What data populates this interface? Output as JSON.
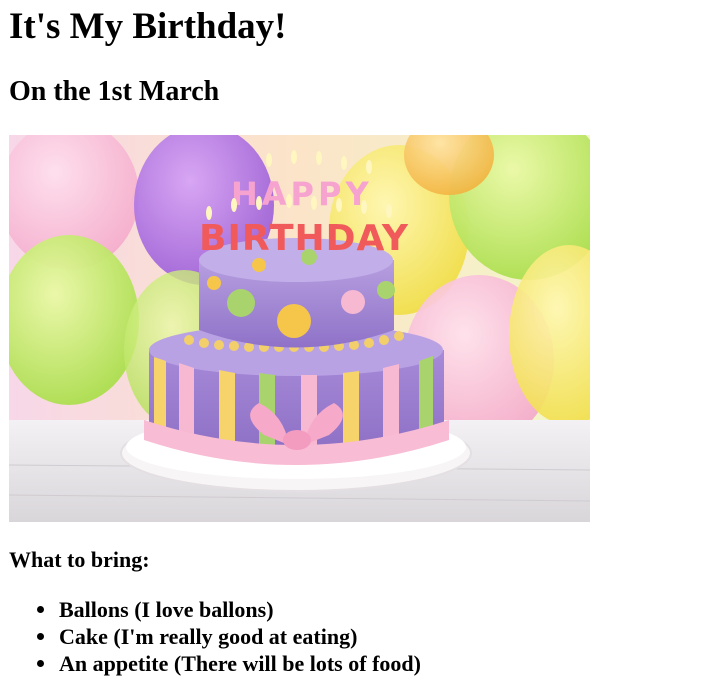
{
  "heading": "It's My Birthday!",
  "subheading": "On the 1st March",
  "image": {
    "icon": "birthday-cake-image",
    "topper_word_1": "HAPPY",
    "topper_word_2": "BIRTHDAY"
  },
  "bring": {
    "label": "What to bring:",
    "items": [
      "Ballons (I love ballons)",
      "Cake (I'm really good at eating)",
      "An appetite (There will be lots of food)"
    ]
  }
}
